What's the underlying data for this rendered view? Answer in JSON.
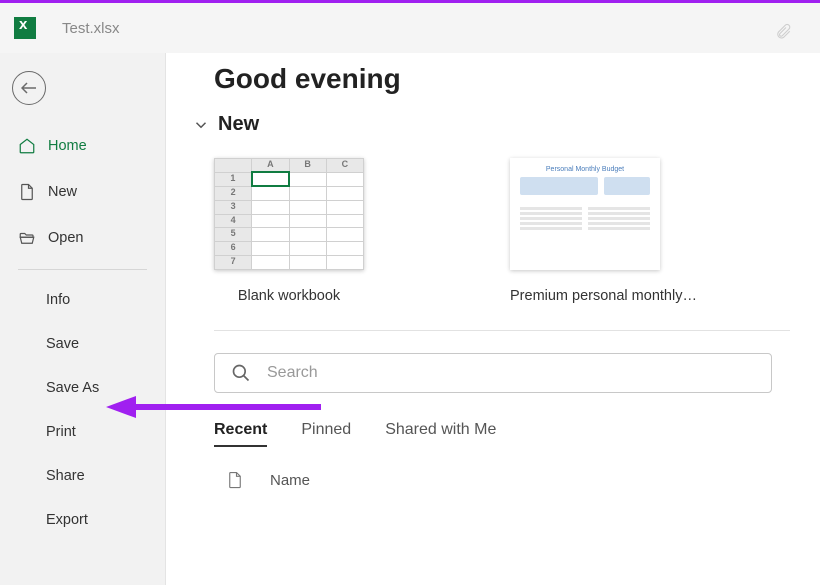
{
  "titlebar": {
    "filename": "Test.xlsx"
  },
  "sidebar": {
    "items": [
      {
        "label": "Home",
        "icon": "home-icon",
        "active": true
      },
      {
        "label": "New",
        "icon": "new-doc-icon"
      },
      {
        "label": "Open",
        "icon": "folder-open-icon"
      }
    ],
    "secondary": [
      {
        "label": "Info"
      },
      {
        "label": "Save"
      },
      {
        "label": "Save As"
      },
      {
        "label": "Print"
      },
      {
        "label": "Share"
      },
      {
        "label": "Export"
      }
    ]
  },
  "main": {
    "greeting": "Good evening",
    "new_section": {
      "title": "New",
      "templates": [
        {
          "label": "Blank workbook"
        },
        {
          "label": "Premium personal monthly…"
        }
      ]
    },
    "search": {
      "placeholder": "Search"
    },
    "tabs": [
      {
        "label": "Recent",
        "active": true
      },
      {
        "label": "Pinned"
      },
      {
        "label": "Shared with Me"
      }
    ],
    "files": {
      "name_header": "Name"
    }
  },
  "colors": {
    "accent": "#107c41",
    "annotation": "#a020f0"
  }
}
